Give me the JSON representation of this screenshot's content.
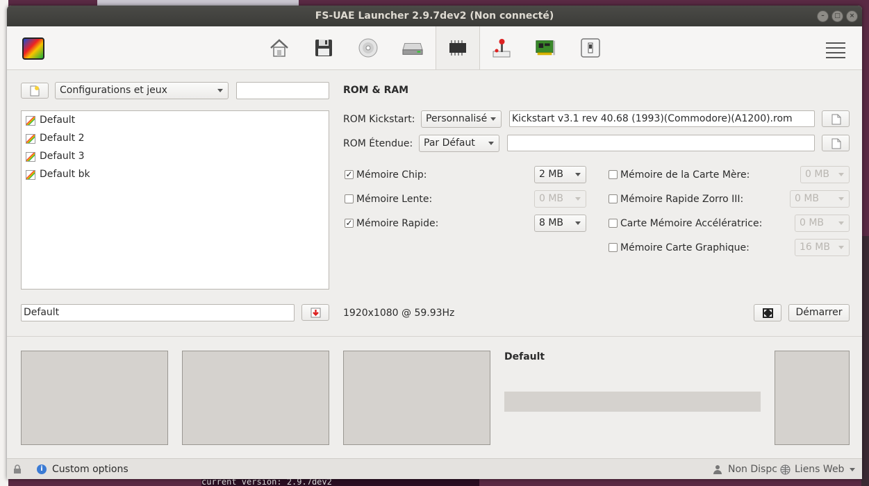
{
  "window": {
    "title": "FS-UAE Launcher 2.9.7dev2 (Non connecté)"
  },
  "toolbar": {
    "icons": [
      "home-icon",
      "floppy-icon",
      "cdrom-icon",
      "harddrive-icon",
      "chip-icon",
      "joystick-icon",
      "expansion-card-icon",
      "switch-icon"
    ],
    "active_index": 4
  },
  "left": {
    "config_filter": "Configurations et jeux",
    "search_value": "",
    "items": [
      "Default",
      "Default 2",
      "Default 3",
      "Default bk"
    ],
    "config_name": "Default"
  },
  "rom_ram": {
    "title": "ROM & RAM",
    "kickstart_label": "ROM Kickstart:",
    "kickstart_mode": "Personnalisé",
    "kickstart_file": "Kickstart v3.1 rev 40.68 (1993)(Commodore)(A1200).rom",
    "extended_label": "ROM Étendue:",
    "extended_mode": "Par Défaut",
    "extended_file": "",
    "memory_left": [
      {
        "label": "Mémoire Chip:",
        "checked": true,
        "value": "2 MB",
        "enabled": true
      },
      {
        "label": "Mémoire Lente:",
        "checked": false,
        "value": "0 MB",
        "enabled": false
      },
      {
        "label": "Mémoire Rapide:",
        "checked": true,
        "value": "8 MB",
        "enabled": true
      }
    ],
    "memory_right": [
      {
        "label": "Mémoire de la Carte Mère:",
        "checked": false,
        "value": "0 MB",
        "enabled": false
      },
      {
        "label": "Mémoire Rapide Zorro III:",
        "checked": false,
        "value": "0 MB",
        "enabled": false
      },
      {
        "label": "Carte Mémoire Accélératrice:",
        "checked": false,
        "value": "0 MB",
        "enabled": false
      },
      {
        "label": "Mémoire Carte Graphique:",
        "checked": false,
        "value": "16 MB",
        "enabled": false
      }
    ]
  },
  "resolution": "1920x1080 @ 59.93Hz",
  "start_label": "Démarrer",
  "preview": {
    "title": "Default"
  },
  "status": {
    "custom_options": "Custom options",
    "netplay": "Non Dispc",
    "links": "Liens Web"
  },
  "desktop": {
    "terminal_text": "current version:  2.9.7dev2"
  }
}
